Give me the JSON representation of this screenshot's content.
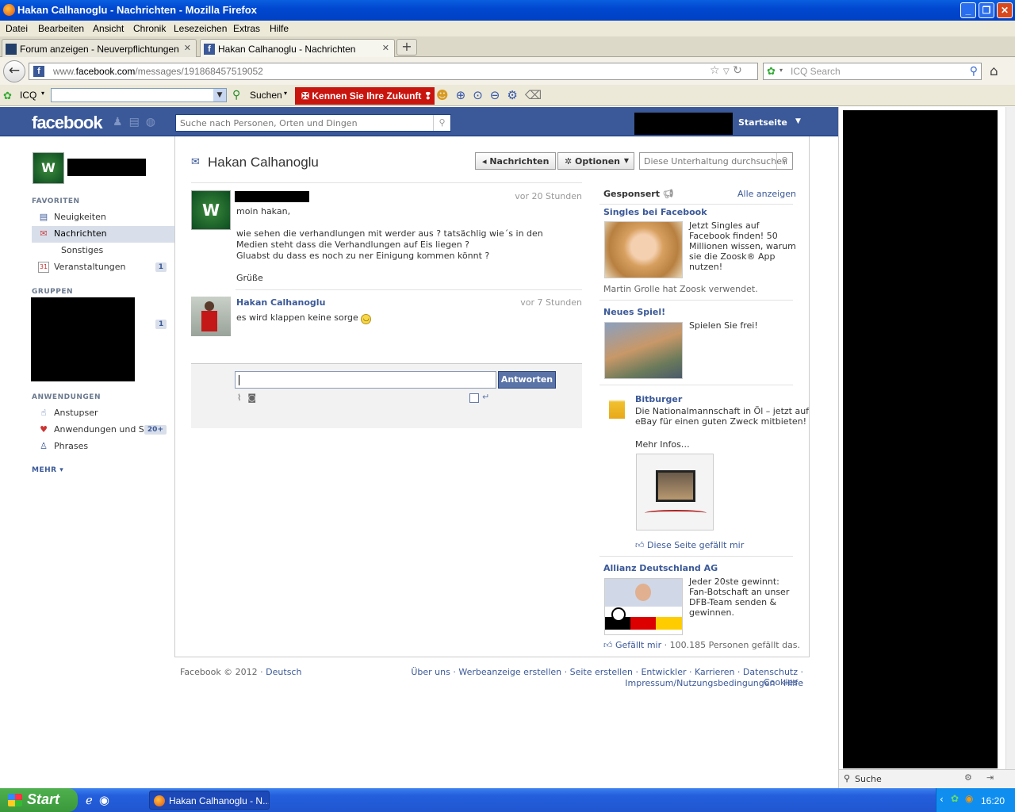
{
  "window": {
    "title": "Hakan Calhanoglu - Nachrichten - Mozilla Firefox"
  },
  "menu": [
    "Datei",
    "Bearbeiten",
    "Ansicht",
    "Chronik",
    "Lesezeichen",
    "Extras",
    "Hilfe"
  ],
  "tabs": [
    {
      "label": "Forum anzeigen - Neuverpflichtungen"
    },
    {
      "label": "Hakan Calhanoglu - Nachrichten"
    }
  ],
  "nav": {
    "url_prefix": "www.",
    "url_domain": "facebook.com",
    "url_path": "/messages/191868457519052",
    "search_placeholder": "ICQ Search"
  },
  "icq": {
    "label": "ICQ",
    "search_label": "Suchen",
    "promo": "✠ Kennen Sie Ihre Zukunft ❢"
  },
  "fb": {
    "logo": "facebook",
    "search_placeholder": "Suche nach Personen, Orten und Dingen",
    "home": "Startseite"
  },
  "sidebar": {
    "favorites_title": "FAVORITEN",
    "items": [
      {
        "label": "Neuigkeiten"
      },
      {
        "label": "Nachrichten"
      },
      {
        "label": "Sonstiges"
      },
      {
        "label": "Veranstaltungen",
        "badge": "1"
      }
    ],
    "groups_title": "GRUPPEN",
    "groups_badge": "1",
    "apps_title": "ANWENDUNGEN",
    "apps": [
      {
        "label": "Anstupser"
      },
      {
        "label": "Anwendungen und S...",
        "badge": "20+"
      },
      {
        "label": "Phrases"
      }
    ],
    "more": "MEHR ▾"
  },
  "conversation": {
    "title": "Hakan Calhanoglu",
    "btn_back": "◂ Nachrichten",
    "btn_options": "✲ Optionen",
    "search_placeholder": "Diese Unterhaltung durchsuchen",
    "messages": [
      {
        "time": "vor 20 Stunden",
        "lines": [
          "moin hakan,",
          "",
          "wie sehen die verhandlungen mit werder aus ? tatsächlig wie´s in den",
          "Medien steht dass die Verhandlungen auf Eis liegen ?",
          "Gluabst du dass es noch zu ner Einigung kommen könnt ?",
          "",
          "Grüße"
        ]
      },
      {
        "name": "Hakan Calhanoglu",
        "time": "vor 7 Stunden",
        "lines": [
          "es wird klappen keine sorge"
        ]
      }
    ],
    "reply_button": "Antworten"
  },
  "ads": {
    "header": "Gesponsert",
    "see_all": "Alle anzeigen",
    "items": [
      {
        "title": "Singles bei Facebook",
        "text": [
          "Jetzt Singles auf",
          "Facebook finden! 50",
          "Millionen wissen, warum",
          "sie die Zoosk® App",
          "nutzen!"
        ],
        "sub": "Martin Grolle hat Zoosk verwendet."
      },
      {
        "title": "Neues Spiel!",
        "text": [
          "Spielen Sie frei!"
        ]
      },
      {
        "title": "Bitburger",
        "text": [
          "Die Nationalmannschaft in Öl – jetzt auf",
          "eBay für einen guten Zweck mitbieten!",
          "",
          "Mehr Infos…"
        ],
        "like": "Diese Seite gefällt mir"
      },
      {
        "title": "Allianz Deutschland AG",
        "text": [
          "Jeder 20ste gewinnt:",
          "Fan-Botschaft an unser",
          "DFB-Team senden &",
          "gewinnen."
        ],
        "like": "Gefällt mir",
        "likes_count": "· 100.185 Personen gefällt das."
      }
    ]
  },
  "footer": {
    "copyright": "Facebook © 2012 ·",
    "language": "Deutsch",
    "links_row1": "Über uns · Werbeanzeige erstellen · Seite erstellen · Entwickler · Karrieren · Datenschutz · Cookies ·",
    "links_row2": "Impressum/Nutzungsbedingungen · Hilfe"
  },
  "chat": {
    "search": "Suche"
  },
  "taskbar": {
    "start": "Start",
    "task": "Hakan Calhanoglu - N...",
    "clock": "16:20"
  }
}
